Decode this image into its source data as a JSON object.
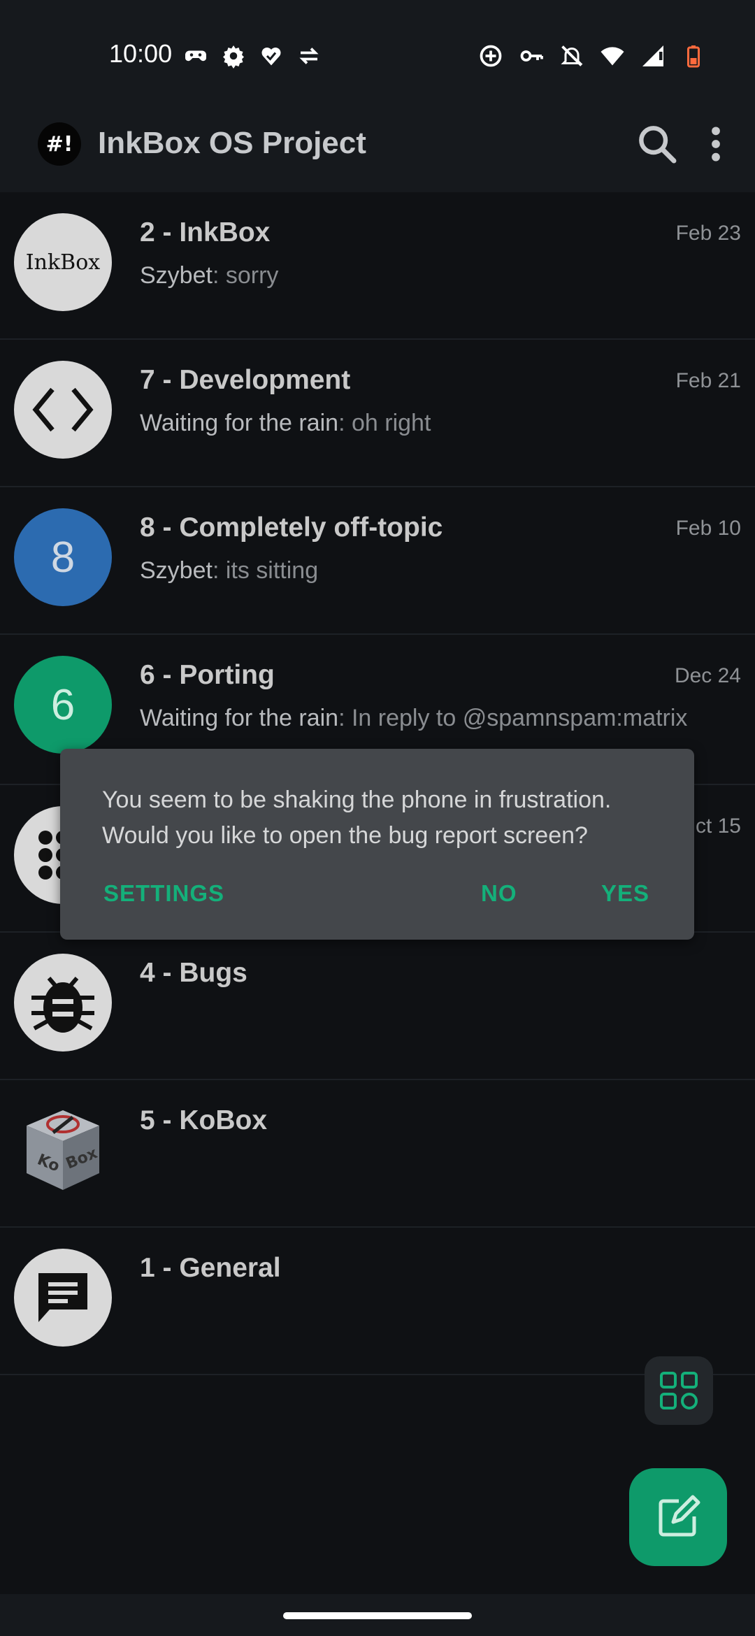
{
  "status_bar": {
    "time": "10:00",
    "left_icons": [
      "game-controller-icon",
      "gear-icon",
      "heart-check-icon",
      "data-transfer-icon"
    ],
    "right_icons": [
      "add-circle-icon",
      "vpn-key-icon",
      "notifications-off-icon",
      "wifi-icon",
      "signal-icon",
      "battery-low-icon"
    ]
  },
  "app_bar": {
    "space_avatar": "#!",
    "title": "InkBox OS Project"
  },
  "rooms": [
    {
      "name": "2 - InkBox",
      "date": "Feb 23",
      "sender": "Szybet",
      "message": ": sorry",
      "avatar_text": "InkBox",
      "avatar_bg": "#d9d9d9"
    },
    {
      "name": "7 - Development",
      "date": "Feb 21",
      "sender": "Waiting for the rain",
      "message": ": oh right",
      "avatar_text": "",
      "avatar_bg": "#d9d9d9"
    },
    {
      "name": "8 - Completely off-topic",
      "date": "Feb 10",
      "sender": "Szybet",
      "message": ": its sitting",
      "avatar_text": "8",
      "avatar_bg": "#2c6bb0"
    },
    {
      "name": "6 - Porting",
      "date": "Dec 24",
      "sender": "Waiting for the rain",
      "message": ": In reply to @spamnspam:matrix",
      "avatar_text": "6",
      "avatar_bg": "#0e9a6a"
    },
    {
      "name": "",
      "date": "ct 15",
      "sender": "",
      "message": "",
      "avatar_text": "",
      "avatar_bg": "#d9d9d9"
    },
    {
      "name": "4 - Bugs",
      "date": "",
      "sender": "",
      "message": "",
      "avatar_text": "",
      "avatar_bg": "#d9d9d9"
    },
    {
      "name": "5 - KoBox",
      "date": "",
      "sender": "",
      "message": "",
      "avatar_text": "",
      "avatar_bg": "#0f1114"
    },
    {
      "name": "1 - General",
      "date": "",
      "sender": "",
      "message": "",
      "avatar_text": "",
      "avatar_bg": "#d9d9d9"
    }
  ],
  "dialog": {
    "line1": "You seem to be shaking the phone in frustration.",
    "line2": "Would you like to open the bug report screen?",
    "settings_label": "SETTINGS",
    "no_label": "NO",
    "yes_label": "YES"
  },
  "colors": {
    "accent": "#14b07a",
    "background": "#0f1114",
    "dialog_bg": "#44474b"
  }
}
